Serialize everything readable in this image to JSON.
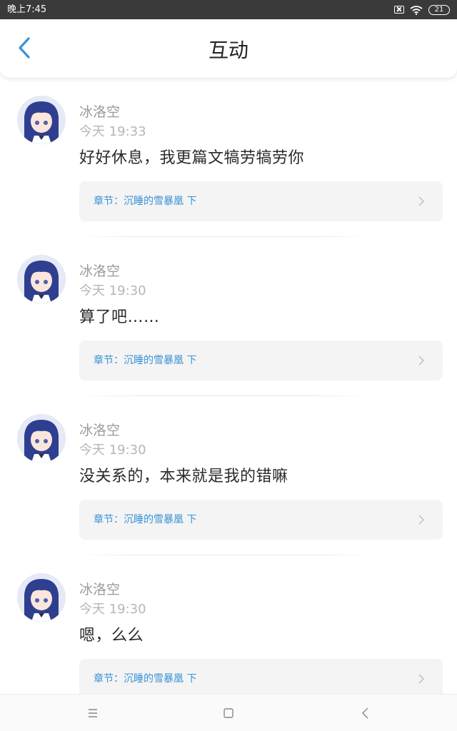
{
  "status_bar": {
    "time": "晚上7:45",
    "battery": "21"
  },
  "header": {
    "title": "互动"
  },
  "comments": [
    {
      "user": "冰洛空",
      "time": "今天 19:33",
      "text": "好好休息，我更篇文犒劳犒劳你",
      "chapter": "章节：沉睡的雪暴凰 下"
    },
    {
      "user": "冰洛空",
      "time": "今天 19:30",
      "text": "算了吧……",
      "chapter": "章节：沉睡的雪暴凰 下"
    },
    {
      "user": "冰洛空",
      "time": "今天 19:30",
      "text": "没关系的，本来就是我的错嘛",
      "chapter": "章节：沉睡的雪暴凰 下"
    },
    {
      "user": "冰洛空",
      "time": "今天 19:30",
      "text": "嗯，么么",
      "chapter": "章节：沉睡的雪暴凰 下"
    }
  ],
  "colors": {
    "accent": "#3a93d6",
    "status_bar": "#3a3a3a",
    "chapter_bg": "#f4f4f4"
  },
  "icons": {
    "back": "chevron-left-icon",
    "chapter_arrow": "chevron-right-icon",
    "status": [
      "close-box-icon",
      "wifi-icon",
      "battery-icon"
    ],
    "nav": [
      "menu-icon",
      "home-square-icon",
      "nav-back-icon"
    ]
  }
}
